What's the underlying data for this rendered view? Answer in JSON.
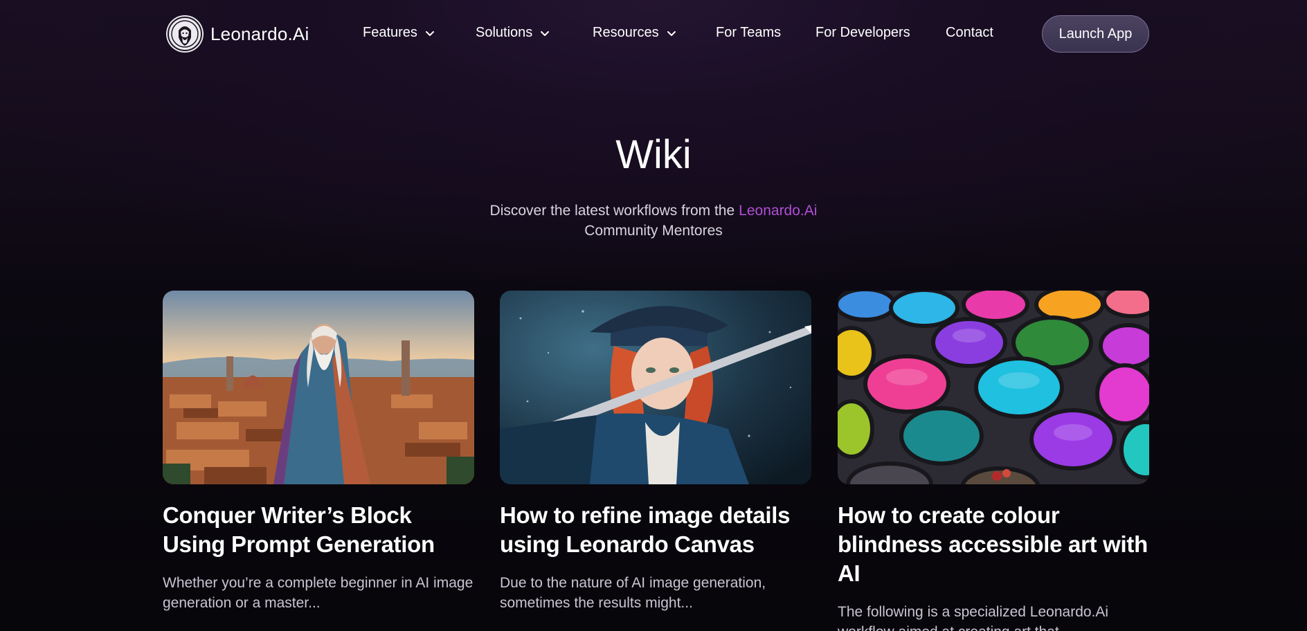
{
  "nav": {
    "logo_text": "Leonardo.Ai",
    "items": [
      {
        "label": "Features",
        "dropdown": true
      },
      {
        "label": "Solutions",
        "dropdown": true
      },
      {
        "label": "Resources",
        "dropdown": true
      },
      {
        "label": "For Teams",
        "dropdown": false
      },
      {
        "label": "For Developers",
        "dropdown": false
      },
      {
        "label": "Contact",
        "dropdown": false
      }
    ],
    "launch_label": "Launch App"
  },
  "hero": {
    "title": "Wiki",
    "subtitle_prefix": "Discover the latest workflows from the",
    "subtitle_brand": "Leonardo.Ai",
    "subtitle_suffix": "Community Mentores"
  },
  "cards": [
    {
      "title": "Conquer Writer’s Block Using Prompt Generation",
      "description": "Whether you’re a complete beginner in AI image generation or a master..."
    },
    {
      "title": "How to refine image details using Leonardo Canvas",
      "description": "Due to the nature of AI image generation, sometimes the results might..."
    },
    {
      "title": "How to create colour blindness accessible art with AI",
      "description": "The following is a specialized Leonardo.Ai workflow aimed at creating art that..."
    }
  ],
  "colors": {
    "background": "#0b0810",
    "accent_brand": "#b04fd6",
    "button_bg": "#433b58"
  }
}
